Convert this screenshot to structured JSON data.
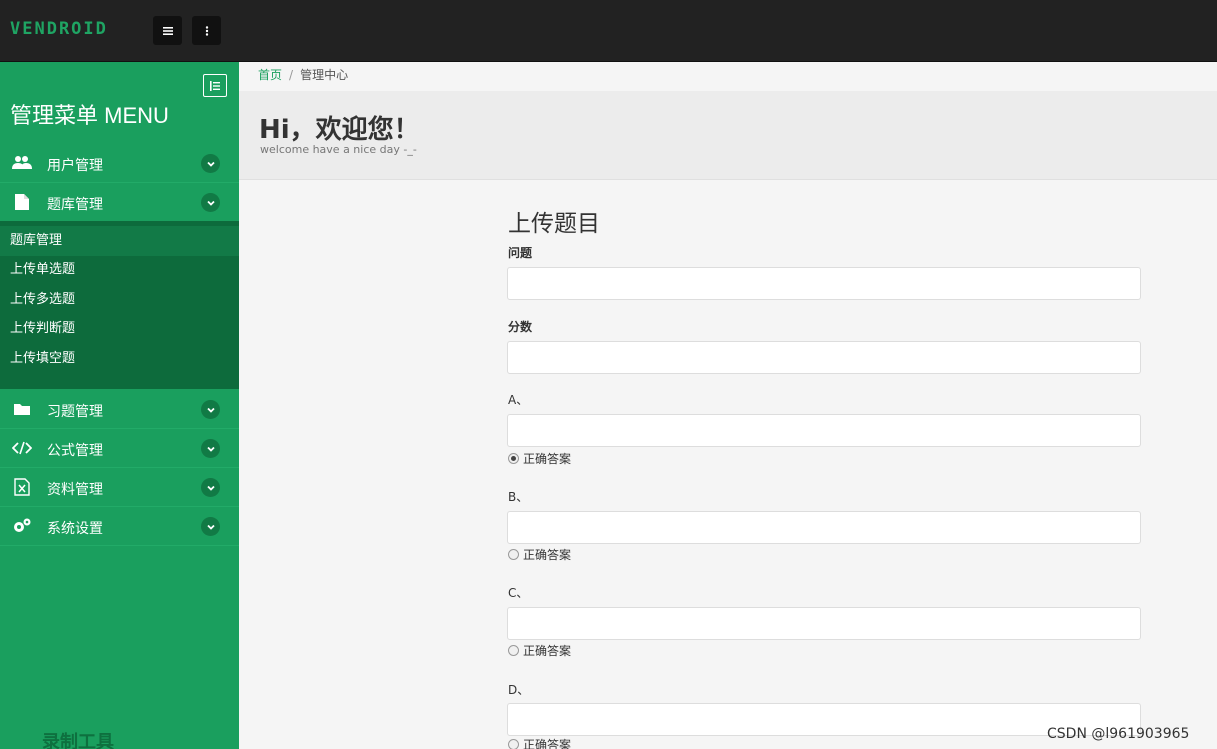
{
  "topbar": {
    "logo": "VENDROID",
    "menu_icon": "hamburger-icon",
    "more_icon": "vertical-dots-icon"
  },
  "sidebar": {
    "title": "管理菜单 MENU",
    "collapse_icon": "collapse-list-icon",
    "items": [
      {
        "label": "用户管理",
        "icon": "users-icon"
      },
      {
        "label": "题库管理",
        "icon": "file-icon"
      },
      {
        "label": "习题管理",
        "icon": "folder-icon"
      },
      {
        "label": "公式管理",
        "icon": "code-icon"
      },
      {
        "label": "资料管理",
        "icon": "excel-file-icon"
      },
      {
        "label": "系统设置",
        "icon": "gears-icon"
      }
    ],
    "submenu": [
      {
        "label": "题库管理"
      },
      {
        "label": "上传单选题"
      },
      {
        "label": "上传多选题"
      },
      {
        "label": "上传判断题"
      },
      {
        "label": "上传填空题"
      }
    ],
    "watermark": "录制工具"
  },
  "breadcrumb": {
    "home": "首页",
    "separator": "/",
    "current": "管理中心"
  },
  "hero": {
    "title": "Hi，欢迎您！",
    "subtitle": "welcome have a nice day -_-"
  },
  "form": {
    "title": "上传题目",
    "question_label": "问题",
    "score_label": "分数",
    "options": [
      {
        "label": "A、",
        "correct_label": "正确答案",
        "checked": true
      },
      {
        "label": "B、",
        "correct_label": "正确答案",
        "checked": false
      },
      {
        "label": "C、",
        "correct_label": "正确答案",
        "checked": false
      },
      {
        "label": "D、",
        "correct_label": "正确答案",
        "checked": false
      }
    ]
  },
  "watermark": "CSDN @l961903965",
  "colors": {
    "topbar": "#222222",
    "sidebar": "#1a9f5e",
    "submenu": "#0d6b3c",
    "accent": "#1fa463"
  }
}
